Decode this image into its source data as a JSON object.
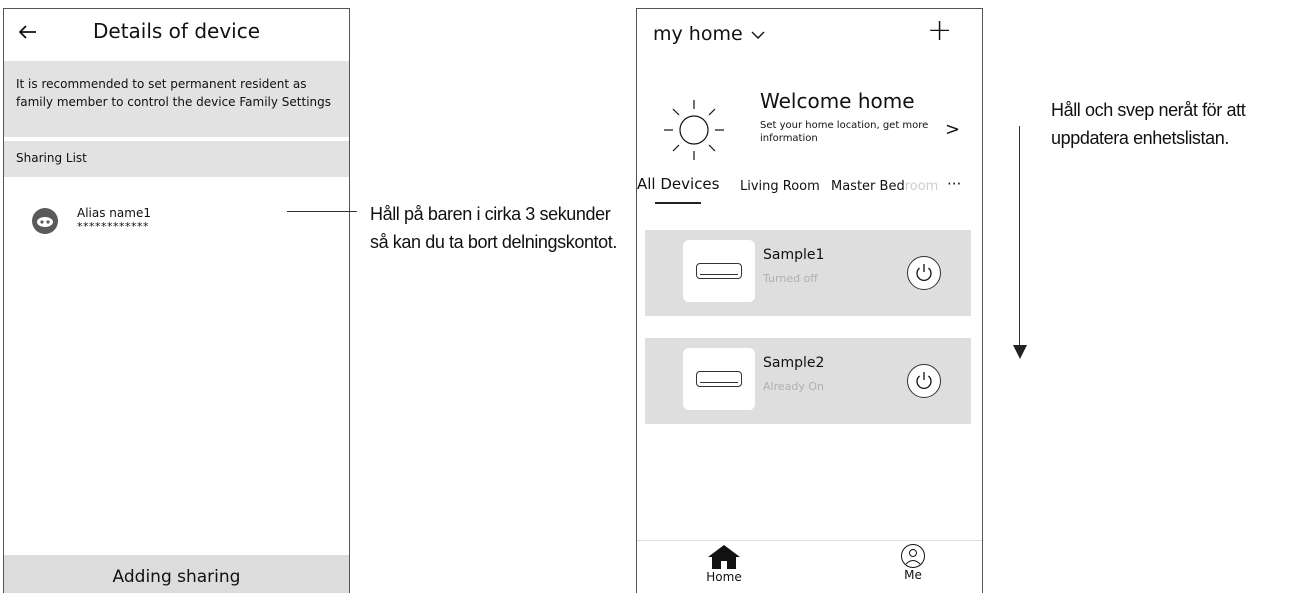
{
  "device_details": {
    "title": "Details of device",
    "notice": "It is recommended to set permanent resident as family member to control the device Family Settings",
    "sharing_list_label": "Sharing List",
    "shared_account": {
      "alias": "Alias name1",
      "masked": "************"
    },
    "add_button": "Adding sharing"
  },
  "annotations": {
    "hold_bar": "Håll på baren i cirka 3 sekunder så kan du ta bort delningskontot.",
    "swipe_down": "Håll och svep neråt för att uppdatera enhetslistan."
  },
  "home": {
    "home_selector": "my home",
    "add_icon": "+",
    "welcome_title": "Welcome home",
    "welcome_subtitle": "Set your home location, get more information",
    "welcome_arrow": ">",
    "tabs": {
      "all": "All Devices",
      "living": "Living Room",
      "master_a": "Master Bed",
      "master_b": "room",
      "more": "···"
    },
    "devices": [
      {
        "name": "Sample1",
        "status": "Turned off"
      },
      {
        "name": "Sample2",
        "status": "Already On"
      }
    ],
    "nav": {
      "home": "Home",
      "me": "Me"
    }
  }
}
